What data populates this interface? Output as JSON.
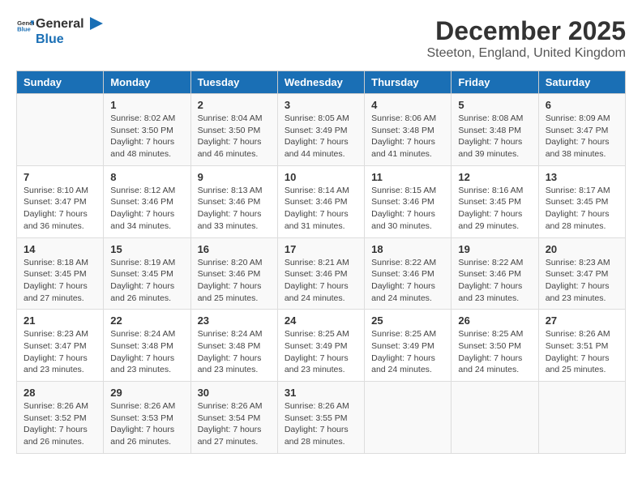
{
  "header": {
    "logo_line1": "General",
    "logo_line2": "Blue",
    "month_title": "December 2025",
    "subtitle": "Steeton, England, United Kingdom"
  },
  "days_of_week": [
    "Sunday",
    "Monday",
    "Tuesday",
    "Wednesday",
    "Thursday",
    "Friday",
    "Saturday"
  ],
  "weeks": [
    [
      {
        "day": "",
        "content": ""
      },
      {
        "day": "1",
        "content": "Sunrise: 8:02 AM\nSunset: 3:50 PM\nDaylight: 7 hours\nand 48 minutes."
      },
      {
        "day": "2",
        "content": "Sunrise: 8:04 AM\nSunset: 3:50 PM\nDaylight: 7 hours\nand 46 minutes."
      },
      {
        "day": "3",
        "content": "Sunrise: 8:05 AM\nSunset: 3:49 PM\nDaylight: 7 hours\nand 44 minutes."
      },
      {
        "day": "4",
        "content": "Sunrise: 8:06 AM\nSunset: 3:48 PM\nDaylight: 7 hours\nand 41 minutes."
      },
      {
        "day": "5",
        "content": "Sunrise: 8:08 AM\nSunset: 3:48 PM\nDaylight: 7 hours\nand 39 minutes."
      },
      {
        "day": "6",
        "content": "Sunrise: 8:09 AM\nSunset: 3:47 PM\nDaylight: 7 hours\nand 38 minutes."
      }
    ],
    [
      {
        "day": "7",
        "content": "Sunrise: 8:10 AM\nSunset: 3:47 PM\nDaylight: 7 hours\nand 36 minutes."
      },
      {
        "day": "8",
        "content": "Sunrise: 8:12 AM\nSunset: 3:46 PM\nDaylight: 7 hours\nand 34 minutes."
      },
      {
        "day": "9",
        "content": "Sunrise: 8:13 AM\nSunset: 3:46 PM\nDaylight: 7 hours\nand 33 minutes."
      },
      {
        "day": "10",
        "content": "Sunrise: 8:14 AM\nSunset: 3:46 PM\nDaylight: 7 hours\nand 31 minutes."
      },
      {
        "day": "11",
        "content": "Sunrise: 8:15 AM\nSunset: 3:46 PM\nDaylight: 7 hours\nand 30 minutes."
      },
      {
        "day": "12",
        "content": "Sunrise: 8:16 AM\nSunset: 3:45 PM\nDaylight: 7 hours\nand 29 minutes."
      },
      {
        "day": "13",
        "content": "Sunrise: 8:17 AM\nSunset: 3:45 PM\nDaylight: 7 hours\nand 28 minutes."
      }
    ],
    [
      {
        "day": "14",
        "content": "Sunrise: 8:18 AM\nSunset: 3:45 PM\nDaylight: 7 hours\nand 27 minutes."
      },
      {
        "day": "15",
        "content": "Sunrise: 8:19 AM\nSunset: 3:45 PM\nDaylight: 7 hours\nand 26 minutes."
      },
      {
        "day": "16",
        "content": "Sunrise: 8:20 AM\nSunset: 3:46 PM\nDaylight: 7 hours\nand 25 minutes."
      },
      {
        "day": "17",
        "content": "Sunrise: 8:21 AM\nSunset: 3:46 PM\nDaylight: 7 hours\nand 24 minutes."
      },
      {
        "day": "18",
        "content": "Sunrise: 8:22 AM\nSunset: 3:46 PM\nDaylight: 7 hours\nand 24 minutes."
      },
      {
        "day": "19",
        "content": "Sunrise: 8:22 AM\nSunset: 3:46 PM\nDaylight: 7 hours\nand 23 minutes."
      },
      {
        "day": "20",
        "content": "Sunrise: 8:23 AM\nSunset: 3:47 PM\nDaylight: 7 hours\nand 23 minutes."
      }
    ],
    [
      {
        "day": "21",
        "content": "Sunrise: 8:23 AM\nSunset: 3:47 PM\nDaylight: 7 hours\nand 23 minutes."
      },
      {
        "day": "22",
        "content": "Sunrise: 8:24 AM\nSunset: 3:48 PM\nDaylight: 7 hours\nand 23 minutes."
      },
      {
        "day": "23",
        "content": "Sunrise: 8:24 AM\nSunset: 3:48 PM\nDaylight: 7 hours\nand 23 minutes."
      },
      {
        "day": "24",
        "content": "Sunrise: 8:25 AM\nSunset: 3:49 PM\nDaylight: 7 hours\nand 23 minutes."
      },
      {
        "day": "25",
        "content": "Sunrise: 8:25 AM\nSunset: 3:49 PM\nDaylight: 7 hours\nand 24 minutes."
      },
      {
        "day": "26",
        "content": "Sunrise: 8:25 AM\nSunset: 3:50 PM\nDaylight: 7 hours\nand 24 minutes."
      },
      {
        "day": "27",
        "content": "Sunrise: 8:26 AM\nSunset: 3:51 PM\nDaylight: 7 hours\nand 25 minutes."
      }
    ],
    [
      {
        "day": "28",
        "content": "Sunrise: 8:26 AM\nSunset: 3:52 PM\nDaylight: 7 hours\nand 26 minutes."
      },
      {
        "day": "29",
        "content": "Sunrise: 8:26 AM\nSunset: 3:53 PM\nDaylight: 7 hours\nand 26 minutes."
      },
      {
        "day": "30",
        "content": "Sunrise: 8:26 AM\nSunset: 3:54 PM\nDaylight: 7 hours\nand 27 minutes."
      },
      {
        "day": "31",
        "content": "Sunrise: 8:26 AM\nSunset: 3:55 PM\nDaylight: 7 hours\nand 28 minutes."
      },
      {
        "day": "",
        "content": ""
      },
      {
        "day": "",
        "content": ""
      },
      {
        "day": "",
        "content": ""
      }
    ]
  ]
}
